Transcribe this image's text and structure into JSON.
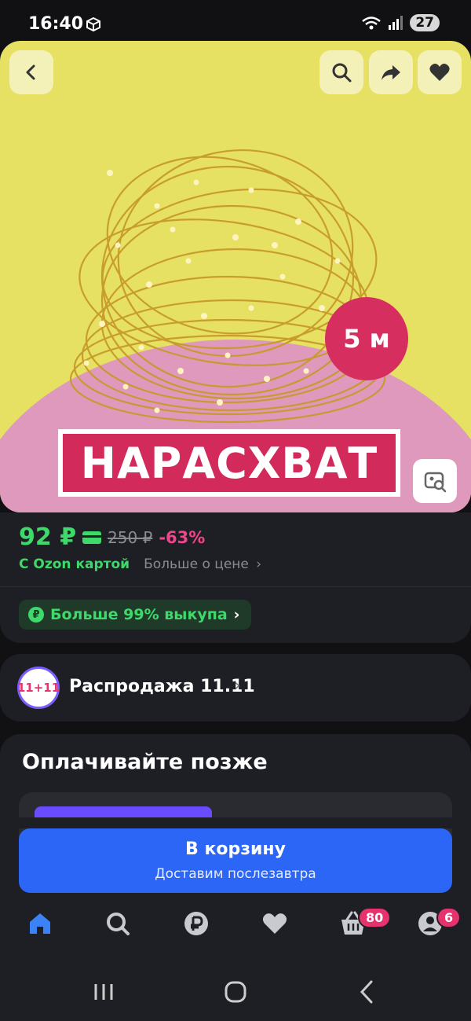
{
  "status": {
    "time": "16:40",
    "battery": "27",
    "net": "5"
  },
  "product": {
    "badge": "5 м",
    "banner": "НАРАСХВАТ"
  },
  "price": {
    "current": "92 ₽",
    "old": "250 ₽",
    "discount": "-63%",
    "ozon_card": "С Ozon картой",
    "more": "Больше о цене",
    "buyout": "Больше 99% выкупа"
  },
  "sale": {
    "logo": "11+11",
    "label": "Распродажа 11.11"
  },
  "paylater": {
    "title": "Оплачивайте позже"
  },
  "cart": {
    "label": "В корзину",
    "sub": "Доставим послезавтра"
  },
  "nav": {
    "cart_badge": "80",
    "profile_badge": "6"
  },
  "colors": {
    "accent_green": "#3ed96a",
    "accent_blue": "#2b66f6",
    "accent_pink": "#e6336e"
  }
}
